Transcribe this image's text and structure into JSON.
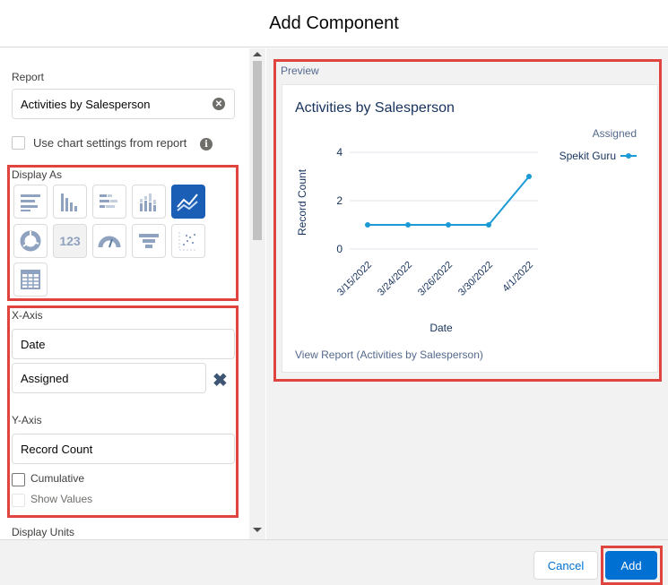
{
  "modal": {
    "title": "Add Component"
  },
  "report": {
    "label": "Report",
    "value": "Activities by Salesperson"
  },
  "use_chart_settings": {
    "label": "Use chart settings from report",
    "checked": false
  },
  "display_as": {
    "label": "Display As",
    "options": [
      {
        "icon": "horizontal-bar-chart-icon",
        "selected": false
      },
      {
        "icon": "vertical-bar-chart-icon",
        "selected": false
      },
      {
        "icon": "stacked-horizontal-bar-icon",
        "selected": false
      },
      {
        "icon": "stacked-vertical-bar-icon",
        "selected": false
      },
      {
        "icon": "line-chart-icon",
        "selected": true
      },
      {
        "icon": "donut-chart-icon",
        "selected": false
      },
      {
        "icon": "metric-icon",
        "glyph": "123",
        "selected": false
      },
      {
        "icon": "gauge-icon",
        "selected": false
      },
      {
        "icon": "funnel-icon",
        "selected": false
      },
      {
        "icon": "scatter-plot-icon",
        "selected": false
      },
      {
        "icon": "table-icon",
        "selected": false
      }
    ]
  },
  "x_axis": {
    "label": "X-Axis",
    "value": "Date",
    "group_value": "Assigned"
  },
  "y_axis": {
    "label": "Y-Axis",
    "value": "Record Count"
  },
  "cumulative": {
    "label": "Cumulative",
    "checked": false
  },
  "show_values": {
    "label": "Show Values",
    "checked": false
  },
  "display_units": {
    "label": "Display Units"
  },
  "preview": {
    "label": "Preview",
    "title": "Activities by Salesperson",
    "view_report": "View Report (Activities by Salesperson)"
  },
  "chart_data": {
    "type": "line",
    "title": "Activities by Salesperson",
    "xlabel": "Date",
    "ylabel": "Record Count",
    "categories": [
      "3/15/2022",
      "3/24/2022",
      "3/26/2022",
      "3/30/2022",
      "4/1/2022"
    ],
    "series": [
      {
        "name": "Spekit Guru",
        "values": [
          1,
          1,
          1,
          1,
          3
        ]
      }
    ],
    "ylim": [
      0,
      4
    ],
    "yticks": [
      0,
      2,
      4
    ],
    "legend_title": "Assigned",
    "legend_position": "top-right",
    "grid": true,
    "series_color": "#1b9ad6"
  },
  "footer": {
    "cancel_label": "Cancel",
    "add_label": "Add"
  },
  "colors": {
    "accent": "#0070d2",
    "highlight": "#e0443e",
    "selected_chart_type": "#1b5eb5"
  }
}
